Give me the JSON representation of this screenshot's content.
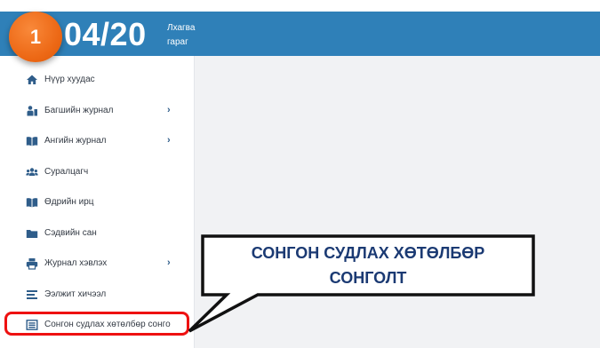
{
  "header": {
    "date": "04/20",
    "weekday_line1": "Лхагва",
    "weekday_line2": "гараг"
  },
  "step_badge": "1",
  "sidebar": {
    "items": [
      {
        "label": "Нүүр хуудас",
        "icon": "home-icon",
        "has_submenu": false
      },
      {
        "label": "Багшийн журнал",
        "icon": "teacher-icon",
        "has_submenu": true
      },
      {
        "label": "Ангийн журнал",
        "icon": "book-icon",
        "has_submenu": true
      },
      {
        "label": "Суралцагч",
        "icon": "users-icon",
        "has_submenu": false
      },
      {
        "label": "Өдрийн ирц",
        "icon": "book-open-icon",
        "has_submenu": false
      },
      {
        "label": "Сэдвийн сан",
        "icon": "folder-icon",
        "has_submenu": false
      },
      {
        "label": "Журнал хэвлэх",
        "icon": "print-icon",
        "has_submenu": true
      },
      {
        "label": "Ээлжит хичээл",
        "icon": "list-icon",
        "has_submenu": false
      },
      {
        "label": "Сонгон судлах хөтөлбөр сонго",
        "icon": "list-box-icon",
        "has_submenu": false
      }
    ],
    "chevron": "›"
  },
  "callout": {
    "line1": "СОНГОН СУДЛАХ ХӨТӨЛБӨР",
    "line2": "СОНГОЛТ"
  },
  "colors": {
    "topbar": "#2f80b8",
    "badge": "#ec6714",
    "highlight": "#ee1111",
    "callout_text": "#1b3a73"
  }
}
